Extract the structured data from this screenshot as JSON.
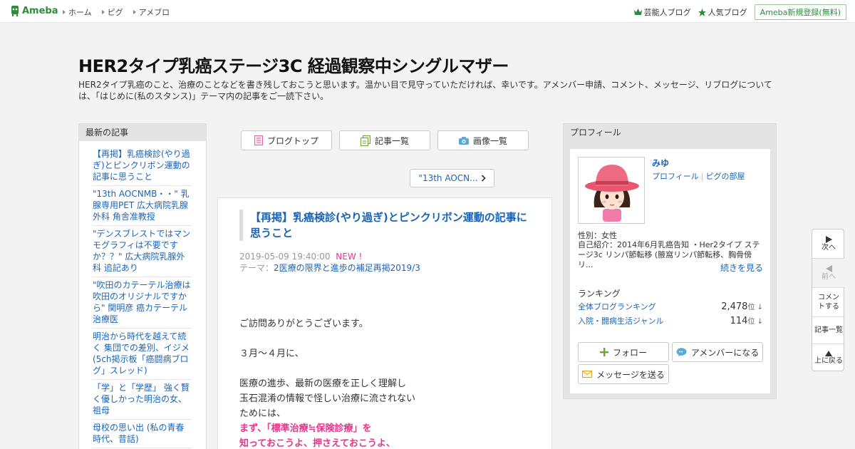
{
  "topbar": {
    "logo": "Ameba",
    "nav": [
      "ホーム",
      "ピグ",
      "アメブロ"
    ],
    "right": [
      "芸能人ブログ",
      "人気ブログ"
    ],
    "register": "Ameba新規登録(無料)"
  },
  "header": {
    "title": "HER2タイプ乳癌ステージ3C 経過観察中シングルマザー",
    "description": "HER2タイプ乳癌のこと、治療のことなどを書き残しておこうと思います。温かい目で見守っていただければ、幸いです。アメンバー申請、コメント、メッセージ、リブログについては、「はじめに(私のスタンス)」テーマ内の記事をご一読下さい。"
  },
  "left": {
    "heading": "最新の記事",
    "items": [
      "【再掲】乳癌検診(やり過ぎ)とピンクリボン運動の記事に思うこと",
      "\"13th AOCNMB・・\" 乳腺専用PET 広大病院乳腺外科 角舎准教授",
      "\"デンスブレストではマンモグラフィは不要ですか？？\" 広大病院乳腺外科 追記あり",
      "\"吹田のカテーテル治療は吹田のオリジナルですから\" 関明彦 癌カテーテル治療医",
      "明治から時代を越えて続く 集団での差別、イジメ (5ch掲示板「癌闘病ブログ」スレッド)",
      "「学」と「学歴」 強く賢く優しかった明治の女、祖母",
      "母校の思い出 (私の青春時代、昔話)"
    ]
  },
  "center": {
    "nav_buttons": [
      "ブログトップ",
      "記事一覧",
      "画像一覧"
    ],
    "next_label": "\"13th AOCN...",
    "article": {
      "title": "【再掲】乳癌検診(やり過ぎ)とピンクリボン運動の記事に思うこと",
      "date": "2019-05-09 19:40:00",
      "new_badge": "NEW !",
      "theme_prefix": "テーマ：",
      "theme": "2医療の限界と進歩の補足再掲2019/3",
      "lines": [
        "ご訪問ありがとうございます。",
        "３月～４月に、",
        "医療の進歩、最新の医療を正しく理解し",
        "玉石混淆の情報で怪しい治療に流されない",
        "ためには、"
      ],
      "highlight_lines": [
        "まず、「標準治療≒保険診療」を",
        "知っておこうよ、押さえておこうよ、"
      ]
    }
  },
  "right": {
    "heading": "プロフィール",
    "name": "みゆ",
    "profile_link": "プロフィール",
    "pig_link": "ピグの部屋",
    "gender": "性別：女性",
    "intro": "自己紹介：2014年6月乳癌告知 ・Her2タイプ ステージ3c リンパ節転移 (腋窩リンパ節転移、胸骨傍リ...",
    "more": "続きを見る",
    "ranking_heading": "ランキング",
    "rankings": [
      {
        "label": "全体ブログランキング",
        "value": "2,478",
        "unit": "位"
      },
      {
        "label": "入院・闘病生活ジャンル",
        "value": "114",
        "unit": "位"
      }
    ],
    "follow": "フォロー",
    "amember": "アメンバーになる",
    "message": "メッセージを送る"
  },
  "sidenav": {
    "next": "次へ",
    "prev": "前へ",
    "comment": "コメントする",
    "list": "記事一覧",
    "top": "上に戻る"
  },
  "colors": {
    "link": "#1a63b5",
    "brand_green": "#2d8c3c",
    "highlight_pink": "#e9348c"
  }
}
